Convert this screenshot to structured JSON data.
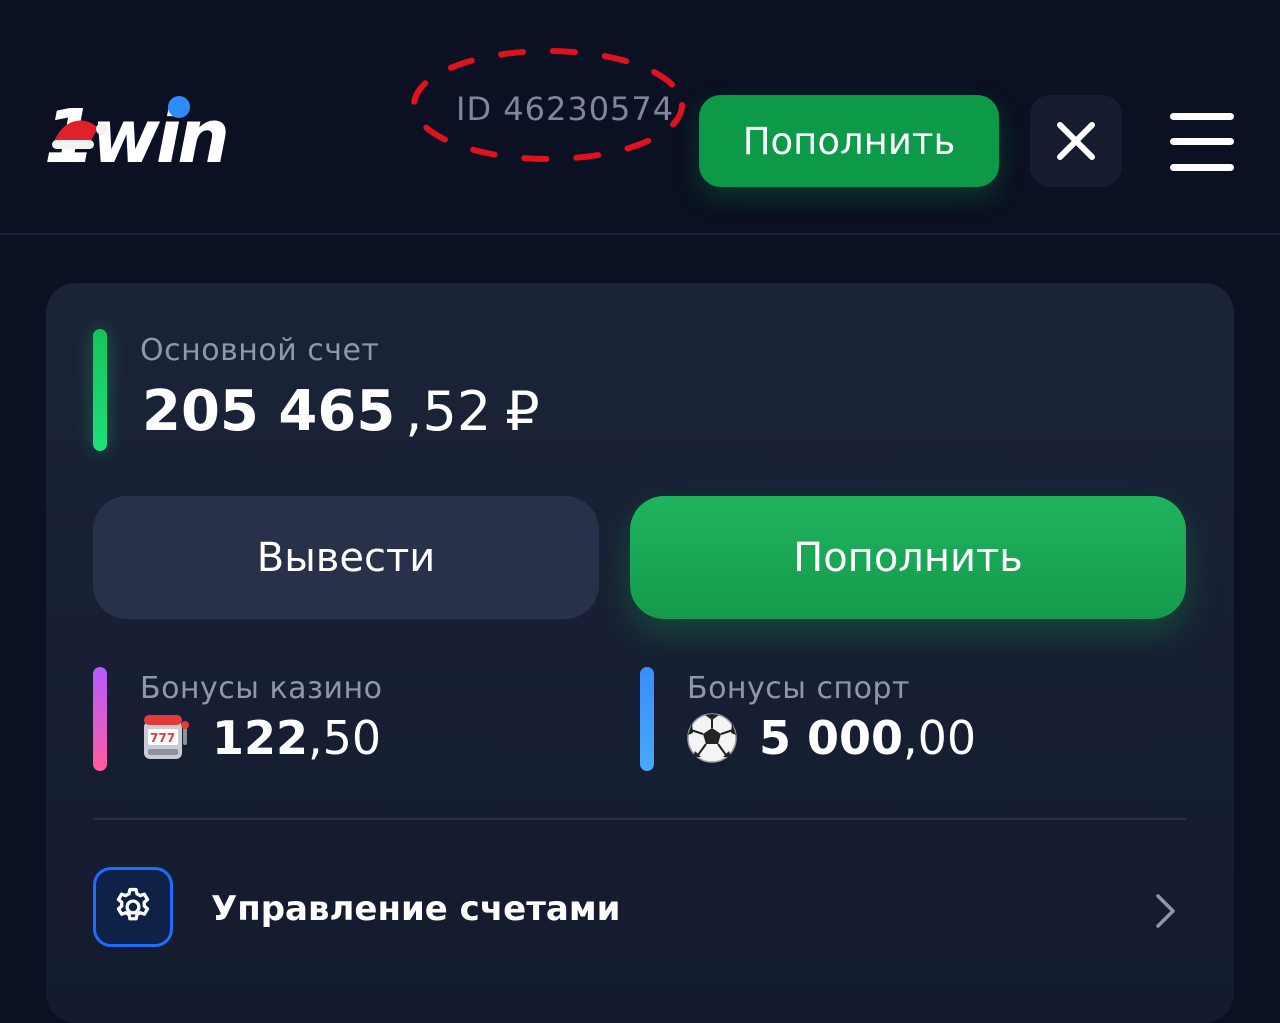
{
  "header": {
    "logo_text": "1win",
    "account_id": "ID 46230574",
    "topup_label": "Пополнить"
  },
  "account": {
    "main_label": "Основной счет",
    "main_amount_int": "205 465",
    "main_amount_dec": ",52",
    "currency": "₽",
    "withdraw_label": "Вывести",
    "topup_label": "Пополнить"
  },
  "bonuses": {
    "casino_label": "Бонусы казино",
    "casino_int": "122",
    "casino_dec": ",50",
    "casino_icon": "slot-machine-icon",
    "sport_label": "Бонусы спорт",
    "sport_int": "5 000",
    "sport_dec": ",00",
    "sport_icon": "soccer-ball-icon"
  },
  "manage": {
    "label": "Управление счетами",
    "icon": "gear-icon"
  },
  "colors": {
    "background": "#0b1022",
    "accent_green": "#0c9a48",
    "main_bar": "#1fe07a",
    "casino_bar": "#c45bff",
    "sport_bar": "#3a8dff",
    "annotation": "#e0121f"
  }
}
